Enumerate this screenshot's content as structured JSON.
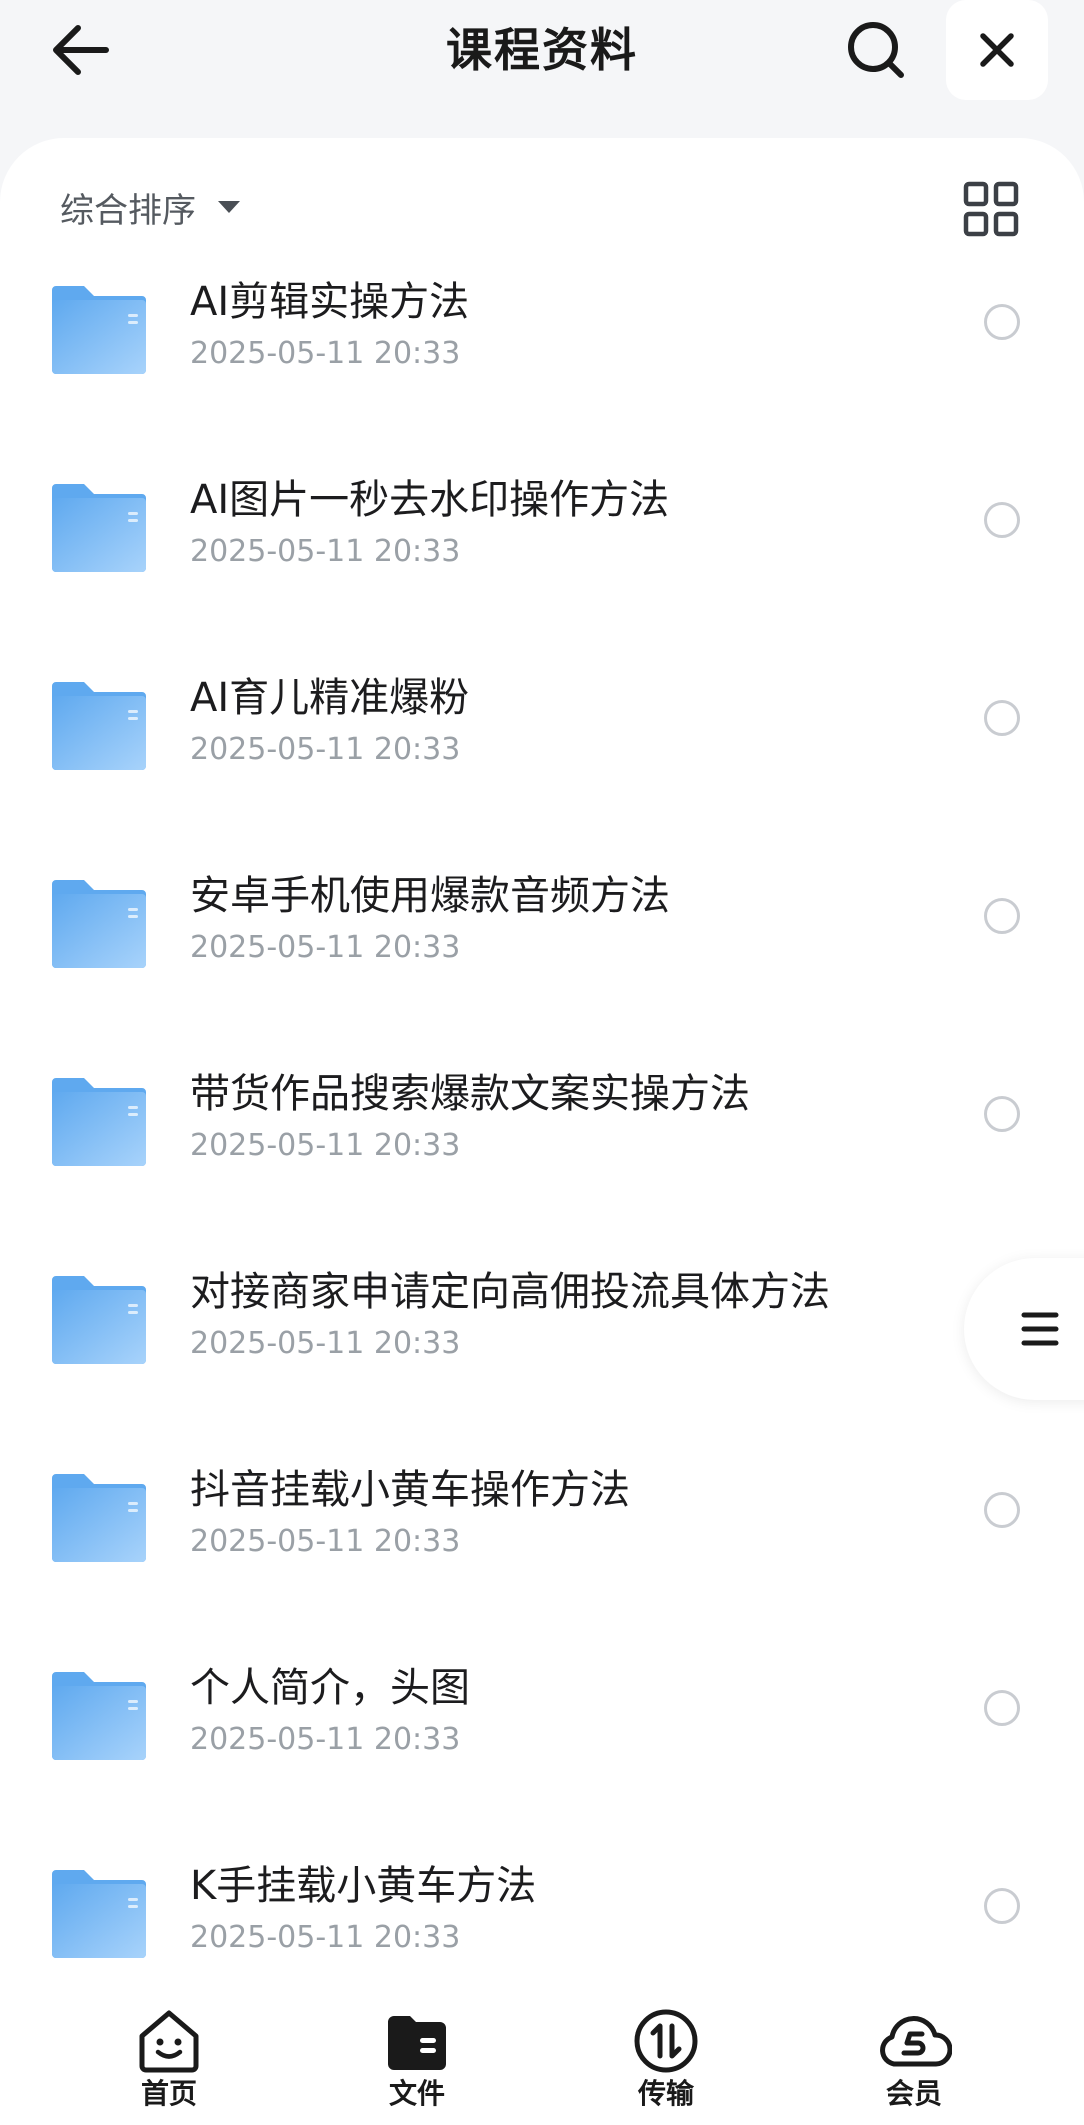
{
  "header": {
    "title": "课程资料",
    "back_icon": "arrow-left-icon",
    "search_icon": "search-icon",
    "close_icon": "close-icon"
  },
  "toolbar": {
    "sort_label": "综合排序",
    "view_icon": "grid-view-icon"
  },
  "files": [
    {
      "name": "AI剪辑实操方法",
      "date": "2025-05-11 20:33"
    },
    {
      "name": "AI图片一秒去水印操作方法",
      "date": "2025-05-11 20:33"
    },
    {
      "name": "AI育儿精准爆粉",
      "date": "2025-05-11 20:33"
    },
    {
      "name": "安卓手机使用爆款音频方法",
      "date": "2025-05-11 20:33"
    },
    {
      "name": "带货作品搜索爆款文案实操方法",
      "date": "2025-05-11 20:33"
    },
    {
      "name": "对接商家申请定向高佣投流具体方法",
      "date": "2025-05-11 20:33"
    },
    {
      "name": "抖音挂载小黄车操作方法",
      "date": "2025-05-11 20:33"
    },
    {
      "name": "个人简介，头图",
      "date": "2025-05-11 20:33"
    },
    {
      "name": "K手挂载小黄车方法",
      "date": "2025-05-11 20:33"
    }
  ],
  "tabs": [
    {
      "label": "首页",
      "icon": "home-smile-icon"
    },
    {
      "label": "文件",
      "icon": "folder-file-icon"
    },
    {
      "label": "传输",
      "icon": "transfer-icon"
    },
    {
      "label": "会员",
      "icon": "vip-cloud-icon"
    }
  ],
  "colors": {
    "folder_light": "#a8d3fb",
    "folder_dark": "#5fa9ef",
    "background": "#f5f6f8",
    "date_text": "#9aa0a6"
  }
}
